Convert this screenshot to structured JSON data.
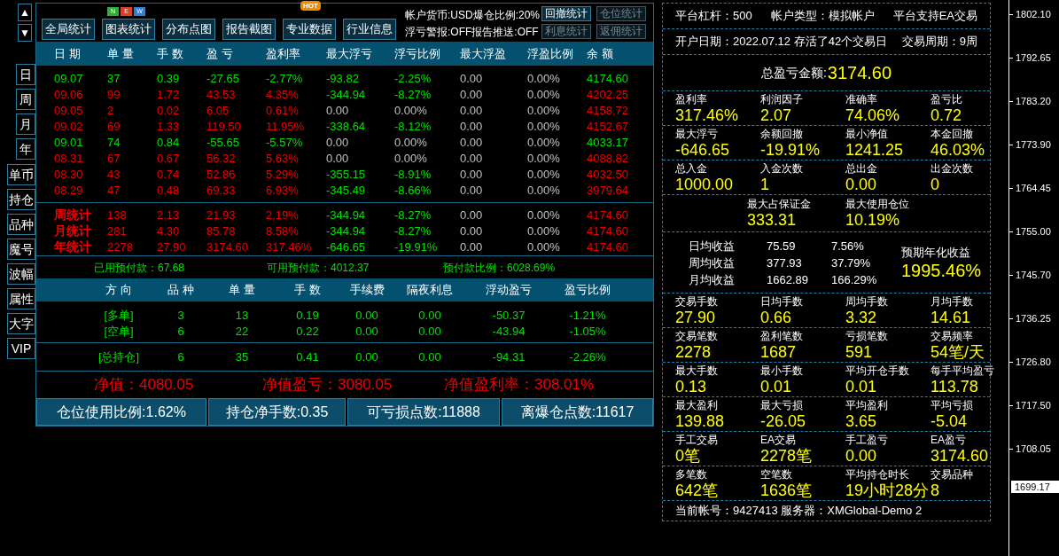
{
  "side_nav": {
    "arrows": [
      "▲",
      "▼"
    ],
    "period_tabs": [
      "日",
      "周",
      "月",
      "年"
    ],
    "tools": [
      "单币",
      "持仓",
      "品种",
      "魔号",
      "波幅",
      "属性",
      "大字",
      "VIP"
    ]
  },
  "toolbar": {
    "buttons": [
      {
        "label": "全局统计"
      },
      {
        "label": "图表统计",
        "badge": {
          "kind": "tiles",
          "letters": [
            "N",
            "E",
            "W"
          ]
        }
      },
      {
        "label": "分布点图"
      },
      {
        "label": "报告截图"
      },
      {
        "label": "专业数据",
        "badge": {
          "kind": "tag",
          "text": "HOT"
        }
      },
      {
        "label": "行业信息"
      }
    ],
    "info": [
      "帐户货币:USD爆仓比例:20%",
      "浮亏警报:OFF报告推送:OFF"
    ],
    "stat_buttons": [
      {
        "label": "回撤统计",
        "disabled": false
      },
      {
        "label": "仓位统计",
        "disabled": true
      },
      {
        "label": "利息统计",
        "disabled": true
      },
      {
        "label": "返佣统计",
        "disabled": true
      }
    ]
  },
  "daily_table": {
    "columns": [
      "日 期",
      "单 量",
      "手 数",
      "盈 亏",
      "盈利率",
      "最大浮亏",
      "浮亏比例",
      "最大浮盈",
      "浮盈比例",
      "余 额"
    ],
    "rows": [
      {
        "cells": [
          {
            "text": "09.07",
            "color": "#00e000"
          },
          {
            "text": "37",
            "color": "#00e000"
          },
          {
            "text": "0.39",
            "color": "#00e000"
          },
          {
            "text": "-27.65",
            "color": "#00e000"
          },
          {
            "text": "-2.77%",
            "color": "#00e000"
          },
          {
            "text": "-93.82",
            "color": "#00e000"
          },
          {
            "text": "-2.25%",
            "color": "#00e000"
          },
          {
            "text": "0.00",
            "color": "#c0c0c0"
          },
          {
            "text": "0.00%",
            "color": "#c0c0c0"
          },
          {
            "text": "4174.60",
            "color": "#00e000"
          }
        ]
      },
      {
        "cells": [
          {
            "text": "09.06",
            "color": "#f00000"
          },
          {
            "text": "99",
            "color": "#f00000"
          },
          {
            "text": "1.72",
            "color": "#f00000"
          },
          {
            "text": "43.53",
            "color": "#f00000"
          },
          {
            "text": "4.35%",
            "color": "#f00000"
          },
          {
            "text": "-344.94",
            "color": "#00e000"
          },
          {
            "text": "-8.27%",
            "color": "#00e000"
          },
          {
            "text": "0.00",
            "color": "#c0c0c0"
          },
          {
            "text": "0.00%",
            "color": "#c0c0c0"
          },
          {
            "text": "4202.25",
            "color": "#f00000"
          }
        ]
      },
      {
        "cells": [
          {
            "text": "09.05",
            "color": "#f00000"
          },
          {
            "text": "2",
            "color": "#f00000"
          },
          {
            "text": "0.02",
            "color": "#f00000"
          },
          {
            "text": "6.05",
            "color": "#f00000"
          },
          {
            "text": "0.61%",
            "color": "#f00000"
          },
          {
            "text": "0.00",
            "color": "#c0c0c0"
          },
          {
            "text": "0.00%",
            "color": "#c0c0c0"
          },
          {
            "text": "0.00",
            "color": "#c0c0c0"
          },
          {
            "text": "0.00%",
            "color": "#c0c0c0"
          },
          {
            "text": "4158.72",
            "color": "#f00000"
          }
        ]
      },
      {
        "cells": [
          {
            "text": "09.02",
            "color": "#f00000"
          },
          {
            "text": "69",
            "color": "#f00000"
          },
          {
            "text": "1.33",
            "color": "#f00000"
          },
          {
            "text": "119.50",
            "color": "#f00000"
          },
          {
            "text": "11.95%",
            "color": "#f00000"
          },
          {
            "text": "-338.64",
            "color": "#00e000"
          },
          {
            "text": "-8.12%",
            "color": "#00e000"
          },
          {
            "text": "0.00",
            "color": "#c0c0c0"
          },
          {
            "text": "0.00%",
            "color": "#c0c0c0"
          },
          {
            "text": "4152.67",
            "color": "#f00000"
          }
        ]
      },
      {
        "cells": [
          {
            "text": "09.01",
            "color": "#00e000"
          },
          {
            "text": "74",
            "color": "#00e000"
          },
          {
            "text": "0.84",
            "color": "#00e000"
          },
          {
            "text": "-55.65",
            "color": "#00e000"
          },
          {
            "text": "-5.57%",
            "color": "#00e000"
          },
          {
            "text": "0.00",
            "color": "#c0c0c0"
          },
          {
            "text": "0.00%",
            "color": "#c0c0c0"
          },
          {
            "text": "0.00",
            "color": "#c0c0c0"
          },
          {
            "text": "0.00%",
            "color": "#c0c0c0"
          },
          {
            "text": "4033.17",
            "color": "#00e000"
          }
        ]
      },
      {
        "cells": [
          {
            "text": "08.31",
            "color": "#f00000"
          },
          {
            "text": "67",
            "color": "#f00000"
          },
          {
            "text": "0.67",
            "color": "#f00000"
          },
          {
            "text": "56.32",
            "color": "#f00000"
          },
          {
            "text": "5.63%",
            "color": "#f00000"
          },
          {
            "text": "0.00",
            "color": "#c0c0c0"
          },
          {
            "text": "0.00%",
            "color": "#c0c0c0"
          },
          {
            "text": "0.00",
            "color": "#c0c0c0"
          },
          {
            "text": "0.00%",
            "color": "#c0c0c0"
          },
          {
            "text": "4088.82",
            "color": "#f00000"
          }
        ]
      },
      {
        "cells": [
          {
            "text": "08.30",
            "color": "#f00000"
          },
          {
            "text": "43",
            "color": "#f00000"
          },
          {
            "text": "0.74",
            "color": "#f00000"
          },
          {
            "text": "52.86",
            "color": "#f00000"
          },
          {
            "text": "5.29%",
            "color": "#f00000"
          },
          {
            "text": "-355.15",
            "color": "#00e000"
          },
          {
            "text": "-8.91%",
            "color": "#00e000"
          },
          {
            "text": "0.00",
            "color": "#c0c0c0"
          },
          {
            "text": "0.00%",
            "color": "#c0c0c0"
          },
          {
            "text": "4032.50",
            "color": "#f00000"
          }
        ]
      },
      {
        "cells": [
          {
            "text": "08.29",
            "color": "#f00000"
          },
          {
            "text": "47",
            "color": "#f00000"
          },
          {
            "text": "0.48",
            "color": "#f00000"
          },
          {
            "text": "69.33",
            "color": "#f00000"
          },
          {
            "text": "6.93%",
            "color": "#f00000"
          },
          {
            "text": "-345.49",
            "color": "#00e000"
          },
          {
            "text": "-8.66%",
            "color": "#00e000"
          },
          {
            "text": "0.00",
            "color": "#c0c0c0"
          },
          {
            "text": "0.00%",
            "color": "#c0c0c0"
          },
          {
            "text": "3979.64",
            "color": "#f00000"
          }
        ]
      }
    ],
    "summary_rows": [
      {
        "cells": [
          {
            "text": "周统计",
            "color": "#f00000"
          },
          {
            "text": "138",
            "color": "#f00000"
          },
          {
            "text": "2.13",
            "color": "#f00000"
          },
          {
            "text": "21.93",
            "color": "#f00000"
          },
          {
            "text": "2.19%",
            "color": "#f00000"
          },
          {
            "text": "-344.94",
            "color": "#00e000"
          },
          {
            "text": "-8.27%",
            "color": "#00e000"
          },
          {
            "text": "0.00",
            "color": "#c0c0c0"
          },
          {
            "text": "0.00%",
            "color": "#c0c0c0"
          },
          {
            "text": "4174.60",
            "color": "#f00000"
          }
        ]
      },
      {
        "cells": [
          {
            "text": "月统计",
            "color": "#f00000"
          },
          {
            "text": "281",
            "color": "#f00000"
          },
          {
            "text": "4.30",
            "color": "#f00000"
          },
          {
            "text": "85.78",
            "color": "#f00000"
          },
          {
            "text": "8.58%",
            "color": "#f00000"
          },
          {
            "text": "-344.94",
            "color": "#00e000"
          },
          {
            "text": "-8.27%",
            "color": "#00e000"
          },
          {
            "text": "0.00",
            "color": "#c0c0c0"
          },
          {
            "text": "0.00%",
            "color": "#c0c0c0"
          },
          {
            "text": "4174.60",
            "color": "#f00000"
          }
        ]
      },
      {
        "cells": [
          {
            "text": "年统计",
            "color": "#f00000"
          },
          {
            "text": "2278",
            "color": "#f00000"
          },
          {
            "text": "27.90",
            "color": "#f00000"
          },
          {
            "text": "3174.60",
            "color": "#f00000"
          },
          {
            "text": "317.46%",
            "color": "#f00000"
          },
          {
            "text": "-646.65",
            "color": "#00e000"
          },
          {
            "text": "-19.91%",
            "color": "#00e000"
          },
          {
            "text": "0.00",
            "color": "#c0c0c0"
          },
          {
            "text": "0.00%",
            "color": "#c0c0c0"
          },
          {
            "text": "4174.60",
            "color": "#f00000"
          }
        ]
      }
    ]
  },
  "prepay": [
    "已用预付款：67.68",
    "可用预付款：4012.37",
    "预付款比例：6028.69%"
  ],
  "positions_table": {
    "columns": [
      "方 向",
      "品 种",
      "单 量",
      "手 数",
      "手续费",
      "隔夜利息",
      "浮动盈亏",
      "盈亏比例"
    ],
    "rows": [
      [
        "[多单]",
        "3",
        "13",
        "0.19",
        "0.00",
        "0.00",
        "-50.37",
        "-1.21%"
      ],
      [
        "[空单]",
        "6",
        "22",
        "0.22",
        "0.00",
        "0.00",
        "-43.94",
        "-1.05%"
      ]
    ],
    "total": [
      "[总持仓]",
      "6",
      "35",
      "0.41",
      "0.00",
      "0.00",
      "-94.31",
      "-2.26%"
    ]
  },
  "net": [
    "净值：4080.05",
    "净值盈亏：3080.05",
    "净值盈利率：308.01%"
  ],
  "bottom_stats": [
    "仓位使用比例:1.62%",
    "持仓净手数:0.35",
    "可亏损点数:11888",
    "离爆仓点数:11617"
  ],
  "account_panel": [
    {
      "kind": "line",
      "texts": [
        "平台杠杆：500",
        "帐户类型：模拟帐户",
        "平台支持EA交易"
      ]
    },
    {
      "kind": "line",
      "texts": [
        "开户日期：2022.07.12 存活了42个交易日",
        "交易周期：9周"
      ]
    },
    {
      "kind": "headline",
      "label": "总盈亏金额:",
      "value": "3174.60"
    },
    {
      "kind": "grid",
      "items": [
        {
          "label": "盈利率",
          "value": "317.46%"
        },
        {
          "label": "利润因子",
          "value": "2.07"
        },
        {
          "label": "准确率",
          "value": "74.06%"
        },
        {
          "label": "盈亏比",
          "value": "0.72"
        }
      ]
    },
    {
      "kind": "grid",
      "items": [
        {
          "label": "最大浮亏",
          "value": "-646.65"
        },
        {
          "label": "余额回撤",
          "value": "-19.91%"
        },
        {
          "label": "最小净值",
          "value": "1241.25"
        },
        {
          "label": "本金回撤",
          "value": "46.03%"
        }
      ]
    },
    {
      "kind": "grid",
      "items": [
        {
          "label": "总入金",
          "value": "1000.00"
        },
        {
          "label": "入金次数",
          "value": "1"
        },
        {
          "label": "总出金",
          "value": "0.00"
        },
        {
          "label": "出金次数",
          "value": "0"
        }
      ]
    },
    {
      "kind": "pair",
      "items": [
        {
          "label": "最大占保证金",
          "value": "333.31"
        },
        {
          "label": "最大使用仓位",
          "value": "10.19%"
        }
      ]
    },
    {
      "kind": "income",
      "rows": [
        [
          "日均收益",
          "75.59",
          "7.56%"
        ],
        [
          "周均收益",
          "377.93",
          "37.79%"
        ],
        [
          "月均收益",
          "1662.89",
          "166.29%"
        ]
      ],
      "label": "预期年化收益",
      "value": "1995.46%"
    },
    {
      "kind": "grid",
      "items": [
        {
          "label": "交易手数",
          "value": "27.90"
        },
        {
          "label": "日均手数",
          "value": "0.66"
        },
        {
          "label": "周均手数",
          "value": "3.32"
        },
        {
          "label": "月均手数",
          "value": "14.61"
        }
      ]
    },
    {
      "kind": "grid",
      "items": [
        {
          "label": "交易笔数",
          "value": "2278"
        },
        {
          "label": "盈利笔数",
          "value": "1687"
        },
        {
          "label": "亏损笔数",
          "value": "591"
        },
        {
          "label": "交易频率",
          "value": "54笔/天"
        }
      ]
    },
    {
      "kind": "grid",
      "items": [
        {
          "label": "最大手数",
          "value": "0.13"
        },
        {
          "label": "最小手数",
          "value": "0.01"
        },
        {
          "label": "平均开仓手数",
          "value": "0.01"
        },
        {
          "label": "每手平均盈亏",
          "value": "113.78"
        }
      ]
    },
    {
      "kind": "grid",
      "items": [
        {
          "label": "最大盈利",
          "value": "139.88"
        },
        {
          "label": "最大亏损",
          "value": "-26.05"
        },
        {
          "label": "平均盈利",
          "value": "3.65"
        },
        {
          "label": "平均亏损",
          "value": "-5.04"
        }
      ]
    },
    {
      "kind": "grid",
      "items": [
        {
          "label": "手工交易",
          "value": "0笔"
        },
        {
          "label": "EA交易",
          "value": "2278笔"
        },
        {
          "label": "手工盈亏",
          "value": "0.00"
        },
        {
          "label": "EA盈亏",
          "value": "3174.60"
        }
      ]
    },
    {
      "kind": "grid",
      "items": [
        {
          "label": "多笔数",
          "value": "642笔"
        },
        {
          "label": "空笔数",
          "value": "1636笔"
        },
        {
          "label": "平均持仓时长",
          "value": "19小时28分"
        },
        {
          "label": "交易品种",
          "value": "8"
        }
      ]
    },
    {
      "kind": "footer",
      "text": "当前帐号：9427413 服务器：XMGlobal-Demo 2"
    }
  ],
  "price_axis": {
    "labels": [
      "1802.10",
      "1792.65",
      "1783.20",
      "1773.90",
      "1764.45",
      "1755.00",
      "1745.70",
      "1736.25",
      "1726.80",
      "1717.50",
      "1708.05"
    ],
    "current": "1699.17"
  }
}
